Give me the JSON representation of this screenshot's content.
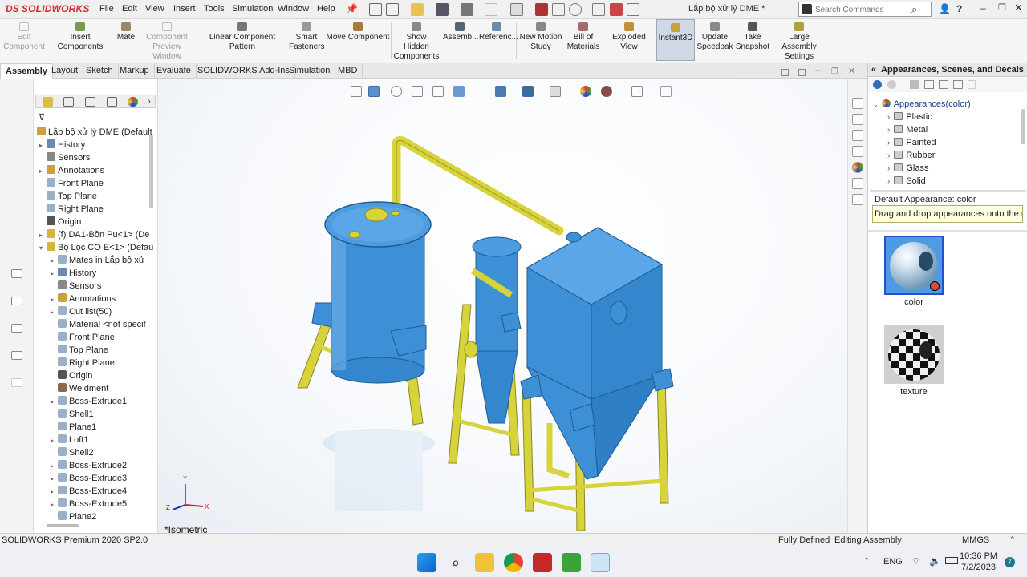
{
  "app": {
    "logo": "SOLIDWORKS",
    "title": "Lắp bộ xử lý DME *"
  },
  "menu": [
    "File",
    "Edit",
    "View",
    "Insert",
    "Tools",
    "Simulation",
    "Window",
    "Help"
  ],
  "search": {
    "placeholder": "Search Commands"
  },
  "commands": {
    "edit_component": "Edit Component",
    "insert_components": "Insert Components",
    "mate": "Mate",
    "component_preview_window": "Component Preview Window",
    "linear_component_pattern": "Linear Component Pattern",
    "smart_fasteners": "Smart Fasteners",
    "move_component": "Move Component",
    "show_hidden_components": "Show Hidden Components",
    "assembly": "Assemb...",
    "reference": "Referenc...",
    "new_motion_study": "New Motion Study",
    "bill_of_materials": "Bill of Materials",
    "exploded_view": "Exploded View",
    "instant3d": "Instant3D",
    "update_speedpak": "Update Speedpak",
    "take_snapshot": "Take Snapshot",
    "large_assembly_settings": "Large Assembly Settings"
  },
  "tabs": [
    "Assembly",
    "Layout",
    "Sketch",
    "Markup",
    "Evaluate",
    "SOLIDWORKS Add-Ins",
    "Simulation",
    "MBD"
  ],
  "active_tab": "Assembly",
  "tree": {
    "root": "Lắp bộ xử lý DME  (Default",
    "items": [
      {
        "label": "History",
        "level": 1,
        "expand": true
      },
      {
        "label": "Sensors",
        "level": 1,
        "expand": false
      },
      {
        "label": "Annotations",
        "level": 1,
        "expand": true
      },
      {
        "label": "Front Plane",
        "level": 1,
        "expand": false
      },
      {
        "label": "Top Plane",
        "level": 1,
        "expand": false
      },
      {
        "label": "Right Plane",
        "level": 1,
        "expand": false
      },
      {
        "label": "Origin",
        "level": 1,
        "expand": false
      },
      {
        "label": "(f) DA1-Bồn Pu<1> (De",
        "level": 1,
        "expand": true
      },
      {
        "label": "Bộ Lọc CO E<1> (Defau",
        "level": 1,
        "expand": true,
        "open": true
      },
      {
        "label": "Mates in Lắp bộ xử l",
        "level": 2,
        "expand": true
      },
      {
        "label": "History",
        "level": 2,
        "expand": true
      },
      {
        "label": "Sensors",
        "level": 2,
        "expand": false
      },
      {
        "label": "Annotations",
        "level": 2,
        "expand": true
      },
      {
        "label": "Cut list(50)",
        "level": 2,
        "expand": true
      },
      {
        "label": "Material <not specif",
        "level": 2,
        "expand": false
      },
      {
        "label": "Front Plane",
        "level": 2,
        "expand": false
      },
      {
        "label": "Top Plane",
        "level": 2,
        "expand": false
      },
      {
        "label": "Right Plane",
        "level": 2,
        "expand": false
      },
      {
        "label": "Origin",
        "level": 2,
        "expand": false
      },
      {
        "label": "Weldment",
        "level": 2,
        "expand": false
      },
      {
        "label": "Boss-Extrude1",
        "level": 2,
        "expand": true
      },
      {
        "label": "Shell1",
        "level": 2,
        "expand": false
      },
      {
        "label": "Plane1",
        "level": 2,
        "expand": false
      },
      {
        "label": "Loft1",
        "level": 2,
        "expand": true
      },
      {
        "label": "Shell2",
        "level": 2,
        "expand": false
      },
      {
        "label": "Boss-Extrude2",
        "level": 2,
        "expand": true
      },
      {
        "label": "Boss-Extrude3",
        "level": 2,
        "expand": true
      },
      {
        "label": "Boss-Extrude4",
        "level": 2,
        "expand": true
      },
      {
        "label": "Boss-Extrude5",
        "level": 2,
        "expand": true
      },
      {
        "label": "Plane2",
        "level": 2,
        "expand": false
      }
    ]
  },
  "viewport": {
    "view_label": "*Isometric"
  },
  "taskpane": {
    "title": "Appearances, Scenes, and Decals",
    "root": "Appearances(color)",
    "folders": [
      "Plastic",
      "Metal",
      "Painted",
      "Rubber",
      "Glass",
      "Solid"
    ],
    "default_appearance": "Default Appearance: color",
    "tooltip": "Drag and drop appearances onto the mo...",
    "swatches": [
      {
        "label": "color"
      },
      {
        "label": "texture"
      }
    ]
  },
  "status": {
    "product": "SOLIDWORKS Premium 2020 SP2.0",
    "defined": "Fully Defined",
    "mode": "Editing Assembly",
    "units": "MMGS"
  },
  "taskbar": {
    "lang": "ENG",
    "time": "10:36 PM",
    "date": "7/2/2023",
    "badge": "7"
  },
  "colors": {
    "accent": "#2f6fb5",
    "equipment_blue": "#3d8fd6",
    "frame_yellow": "#d7d33a"
  }
}
